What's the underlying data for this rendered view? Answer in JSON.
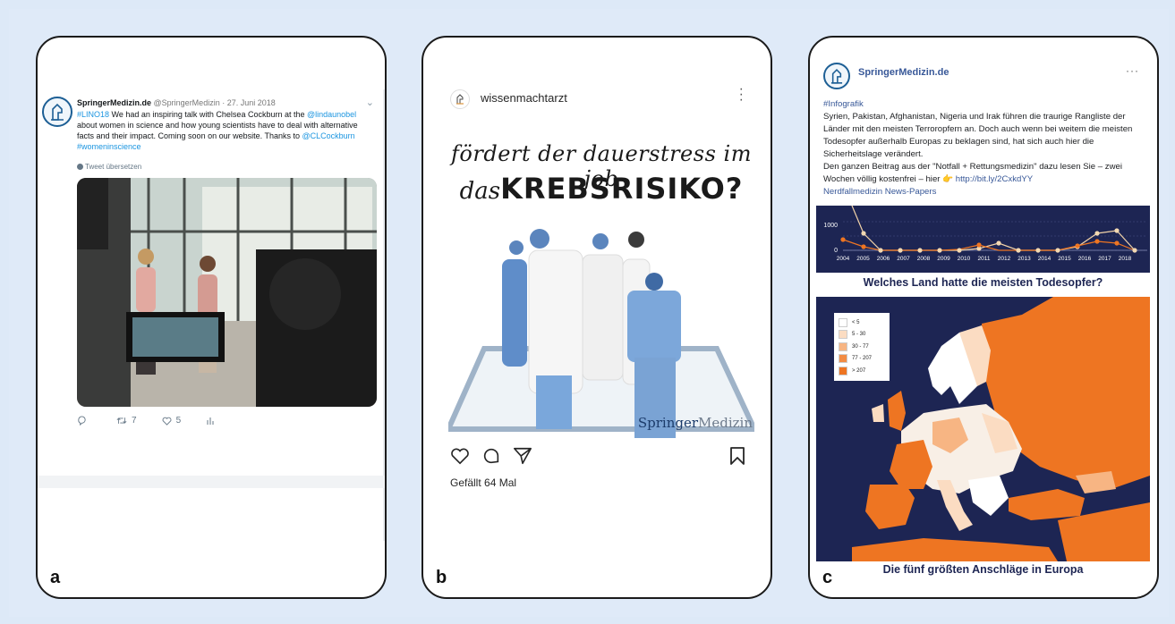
{
  "panels": {
    "a": {
      "letter": "a",
      "tweet": {
        "name": "SpringerMedizin.de",
        "handle": "@SpringerMedizin",
        "date": "· 27. Juni 2018",
        "hashtag": "#LINO18",
        "text_1": " We had an inspiring talk with Chelsea Cockburn at the ",
        "mention_1": "@lindaunobel",
        "text_2": " about women in science and how young scientists have to deal with alternative facts and their impact. Coming soon on our website. Thanks to ",
        "mention_2": "@CLCockburn",
        "hashtag_2": "#womeninscience",
        "translate": "Tweet übersetzen",
        "retweets": "7",
        "likes": "5"
      }
    },
    "b": {
      "letter": "b",
      "instagram": {
        "username": "wissenmachtarzt",
        "headline_line1": "fördert der dauerstress im job",
        "headline_das": "das",
        "headline_krebs": "KREBSRISIKO?",
        "logo_springer": "Springer",
        "logo_medizin": "Medizin",
        "likes_text": "Gefällt 64 Mal"
      }
    },
    "c": {
      "letter": "c",
      "facebook": {
        "name": "SpringerMedizin.de",
        "dots": "···",
        "hashtag": "#Infografik",
        "text_1": "Syrien, Pakistan, Afghanistan, Nigeria und Irak führen die traurige Rangliste der Länder mit den meisten Terroropfern an. Doch auch wenn bei weitem die meisten Todesopfer außerhalb Europas zu beklagen sind, hat sich auch hier die Sicherheitslage verändert.",
        "text_2": "Den ganzen Beitrag aus der \"Notfall + Rettungsmedizin\" dazu lesen Sie – zwei Wochen völlig kostenfrei – hier 👉 ",
        "link": "http://bit.ly/2CxkdYY",
        "newspaper": "Nerdfallmedizin News-Papers",
        "map_title": "Welches Land hatte die meisten Todesopfer?",
        "bottom_title": "Die fünf größten Anschläge in Europa",
        "legend": [
          "< 5",
          "5 - 30",
          "30 - 77",
          "77 - 207",
          "> 207"
        ],
        "legend_colors": [
          "#ffffff",
          "#fbdcc2",
          "#f7b583",
          "#f28c44",
          "#ee7522"
        ],
        "chart_y_ticks": [
          "1000",
          "0"
        ],
        "chart_x_ticks": [
          "2004",
          "2005",
          "2006",
          "2007",
          "2008",
          "2009",
          "2010",
          "2011",
          "2012",
          "2013",
          "2014",
          "2015",
          "2016",
          "2017",
          "2018"
        ]
      }
    }
  }
}
